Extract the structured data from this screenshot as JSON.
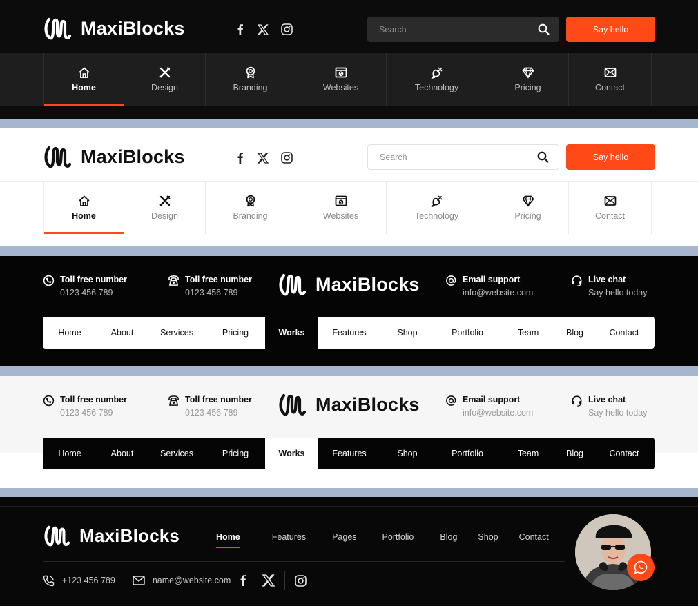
{
  "brand": {
    "name": "MaxiBlocks"
  },
  "colors": {
    "accent": "#ff4a17",
    "dark": "#0c0c0c",
    "divider": "#a6b6cf"
  },
  "header_top": {
    "social_icons": [
      "facebook-icon",
      "x-twitter-icon",
      "instagram-icon"
    ],
    "search": {
      "placeholder": "Search"
    },
    "cta_label": "Say hello",
    "nav": [
      {
        "label": "Home",
        "icon": "home-icon",
        "active": true
      },
      {
        "label": "Design",
        "icon": "design-tools-icon"
      },
      {
        "label": "Branding",
        "icon": "award-icon"
      },
      {
        "label": "Websites",
        "icon": "browser-window-icon"
      },
      {
        "label": "Technology",
        "icon": "satellite-icon"
      },
      {
        "label": "Pricing",
        "icon": "diamond-icon"
      },
      {
        "label": "Contact",
        "icon": "envelope-icon"
      }
    ]
  },
  "header_contact": {
    "items": [
      {
        "title": "Toll free number",
        "sub": "0123 456 789",
        "icon": "phone-badge-icon"
      },
      {
        "title": "Toll free number",
        "sub": "0123 456 789",
        "icon": "telephone-icon"
      },
      {
        "title": "Email support",
        "sub": "info@website.com",
        "icon": "at-icon"
      },
      {
        "title": "Live chat",
        "sub": "Say hello today",
        "icon": "headset-icon"
      }
    ],
    "menu": [
      "Home",
      "About",
      "Services",
      "Pricing",
      "Works",
      "Features",
      "Shop",
      "Portfolio",
      "Team",
      "Blog",
      "Contact"
    ],
    "active_index": 4
  },
  "header_bottom": {
    "nav": [
      "Home",
      "Features",
      "Pages",
      "Portfolio",
      "Blog",
      "Shop",
      "Contact"
    ],
    "phone": "+123 456 789",
    "email": "name@website.com",
    "social_icons": [
      "facebook-icon",
      "x-twitter-icon",
      "instagram-icon"
    ],
    "chat_icon": "whatsapp-icon",
    "avatar": "avatar-photo"
  }
}
